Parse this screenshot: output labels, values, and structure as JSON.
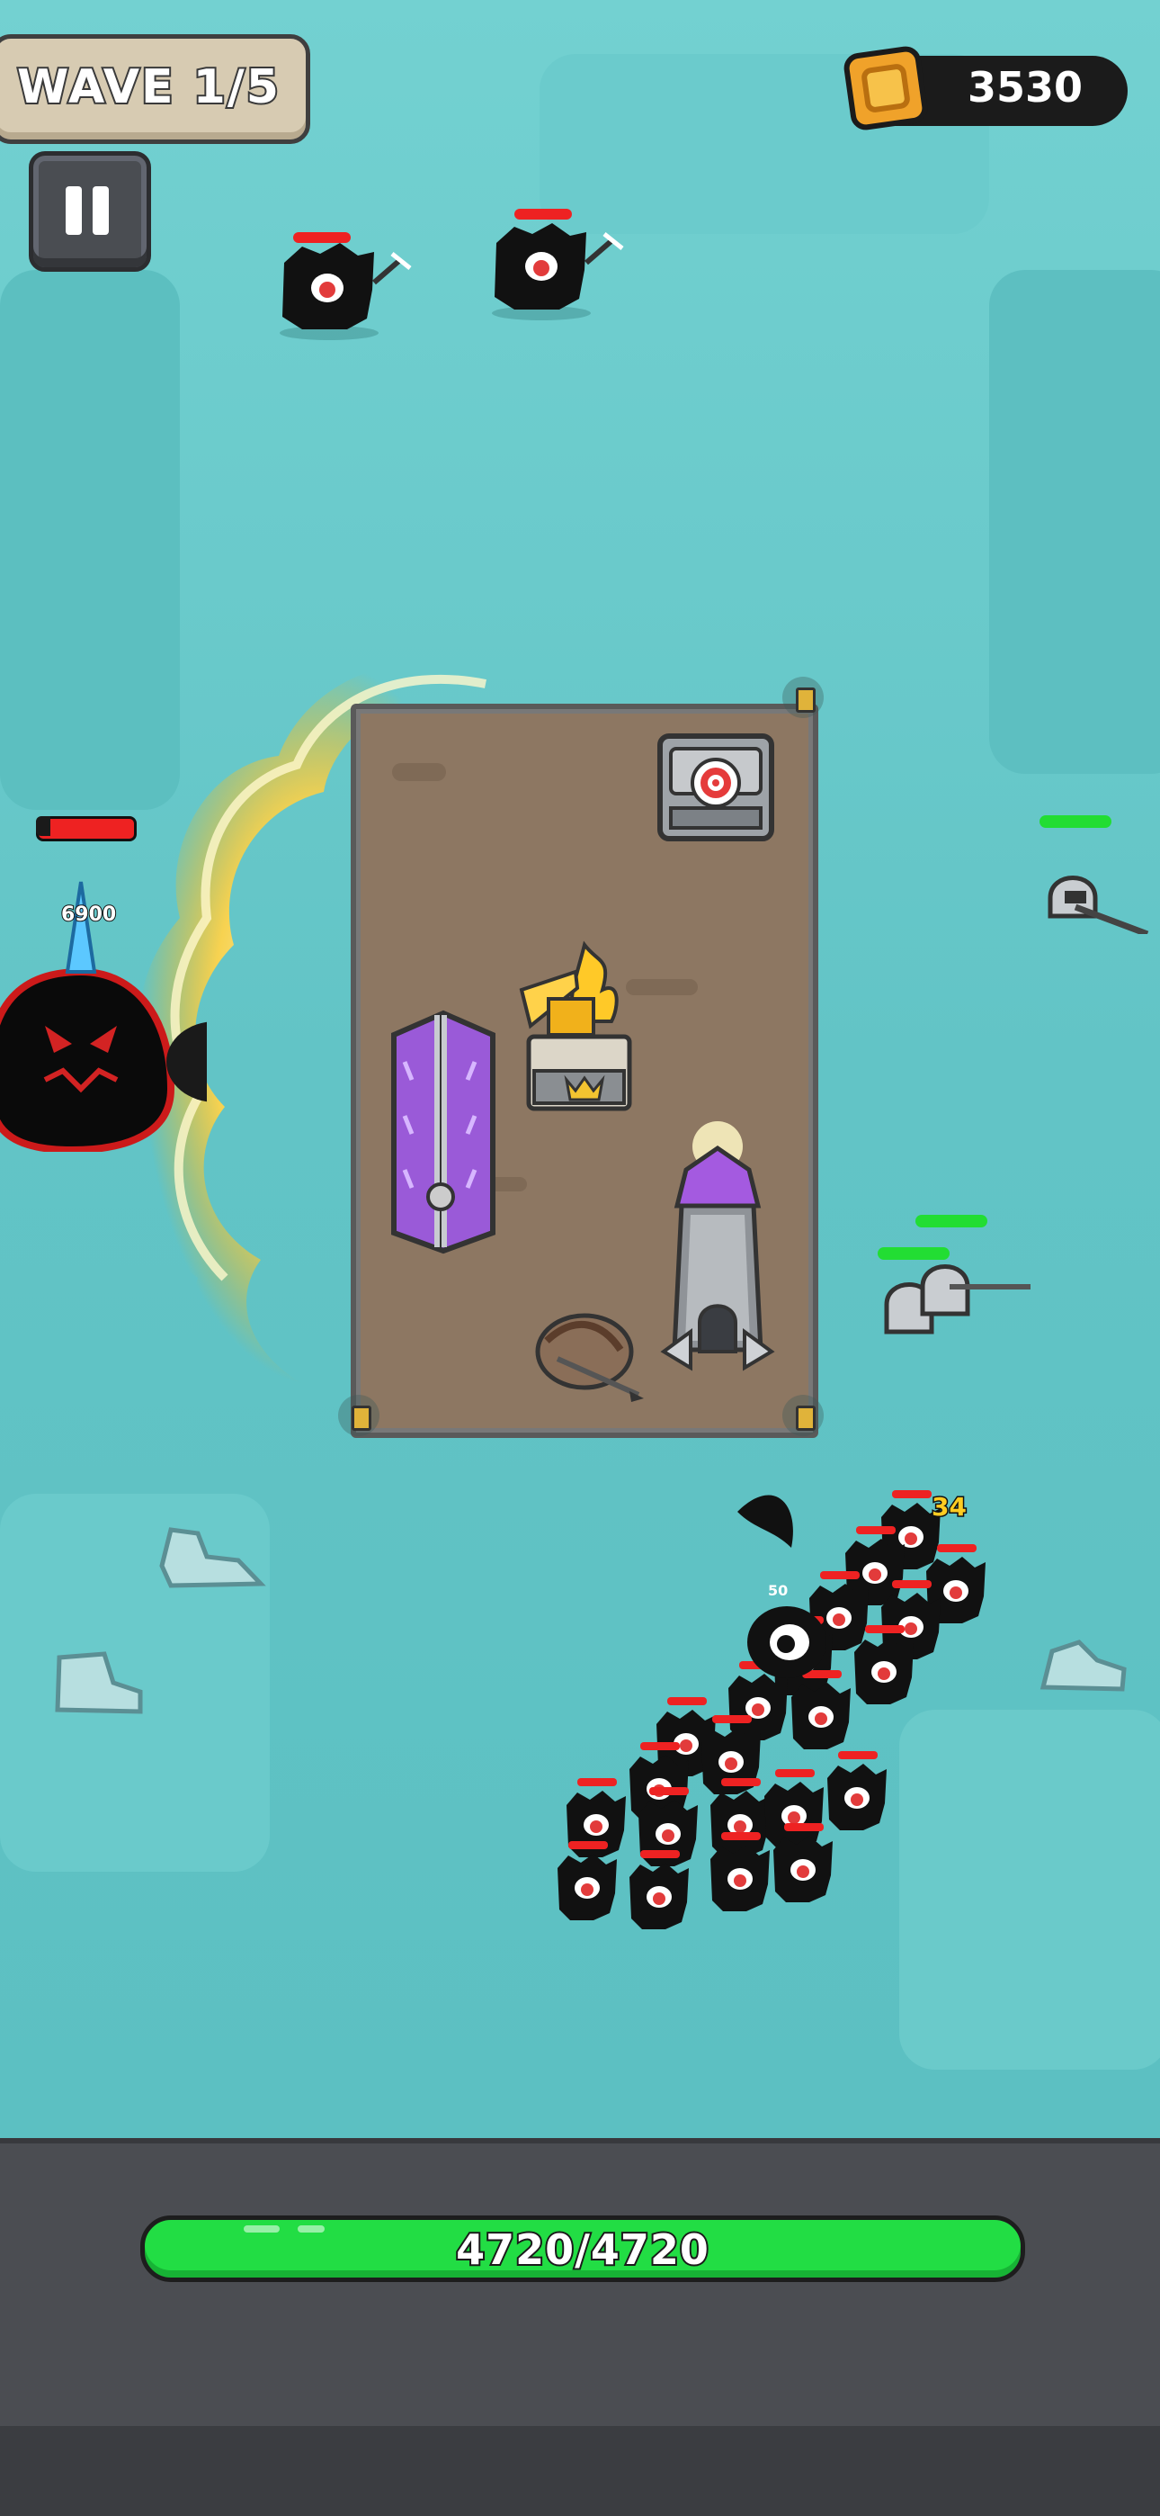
{
  "hud": {
    "wave_label": "WAVE 1/5",
    "coins": "3530",
    "base_health": "4720/4720"
  },
  "boss": {
    "damage_number": "6900"
  },
  "floating_numbers": {
    "crit_damage": "34",
    "small_damage": "50"
  },
  "icons": {
    "pause": "pause-icon",
    "coin": "coin-icon"
  },
  "colors": {
    "accent_hp_green": "#22dd44",
    "enemy_hp_red": "#ee2222",
    "coin_gold": "#e8a020"
  }
}
